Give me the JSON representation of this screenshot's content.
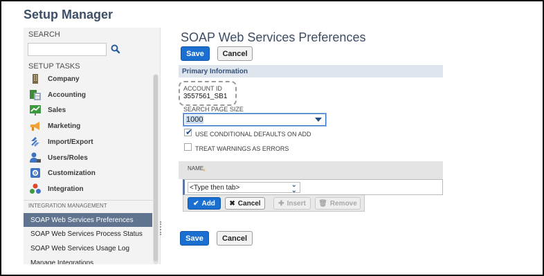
{
  "app": {
    "title": "Setup Manager"
  },
  "sidebar": {
    "search_label": "SEARCH",
    "search_placeholder": "",
    "setup_tasks_label": "SETUP TASKS",
    "tasks": [
      {
        "label": "Company",
        "icon": "building-icon"
      },
      {
        "label": "Accounting",
        "icon": "ledger-icon"
      },
      {
        "label": "Sales",
        "icon": "chart-icon"
      },
      {
        "label": "Marketing",
        "icon": "megaphone-icon"
      },
      {
        "label": "Import/Export",
        "icon": "arrows-icon"
      },
      {
        "label": "Users/Roles",
        "icon": "users-icon"
      },
      {
        "label": "Customization",
        "icon": "gear-box-icon"
      },
      {
        "label": "Integration",
        "icon": "molecule-icon"
      }
    ],
    "section_label": "INTEGRATION MANAGEMENT",
    "management_items": [
      {
        "label": "SOAP Web Services Preferences",
        "active": true
      },
      {
        "label": "SOAP Web Services Process Status",
        "active": false
      },
      {
        "label": "SOAP Web Services Usage Log",
        "active": false
      },
      {
        "label": "Manage Integrations",
        "active": false
      }
    ]
  },
  "main": {
    "title": "SOAP Web Services Preferences",
    "save_label": "Save",
    "cancel_label": "Cancel",
    "section_title": "Primary Information",
    "account_id_label": "ACCOUNT ID",
    "account_id_value": "3557561_SB1",
    "search_page_size_label": "SEARCH PAGE SIZE",
    "search_page_size_value": "1000",
    "checkboxes": [
      {
        "label": "USE CONDITIONAL DEFAULTS ON ADD",
        "checked": true
      },
      {
        "label": "TREAT WARNINGS AS ERRORS",
        "checked": false
      }
    ],
    "grid": {
      "column_name": "NAME",
      "required_mark": "*",
      "row_placeholder": "<Type then tab>",
      "add_label": "Add",
      "cancel_label": "Cancel",
      "insert_label": "Insert",
      "remove_label": "Remove"
    }
  },
  "colors": {
    "primary_button": "#1a6fd1",
    "active_nav": "#607490",
    "section_bar": "#dfe5ed",
    "title": "#3c4c63"
  }
}
